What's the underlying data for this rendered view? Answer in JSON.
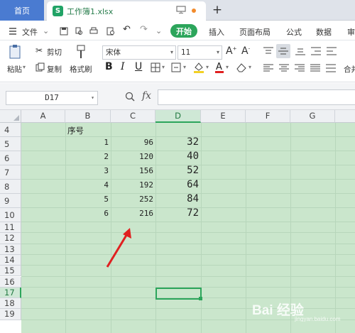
{
  "titlebar": {
    "home_tab": "首页",
    "doc_logo": "S",
    "doc_tab": "工作簿1.xlsx",
    "new_tab": "+"
  },
  "menubar": {
    "file": "文件",
    "start": "开始",
    "items": [
      "插入",
      "页面布局",
      "公式",
      "数据",
      "审"
    ]
  },
  "ribbon": {
    "paste": "粘贴",
    "cut": "剪切",
    "copy": "复制",
    "format_painter": "格式刷",
    "font_name": "宋体",
    "font_size": "11",
    "bold": "B",
    "italic": "I",
    "underline": "U",
    "right_cut": "合并"
  },
  "formula_bar": {
    "name_box": "D17",
    "fx_label": "fx",
    "formula": ""
  },
  "sheet": {
    "columns": [
      "A",
      "B",
      "C",
      "D",
      "E",
      "F",
      "G"
    ],
    "rows": [
      "4",
      "5",
      "6",
      "7",
      "8",
      "9",
      "10",
      "11",
      "12",
      "13",
      "14",
      "15",
      "16",
      "17",
      "18",
      "19"
    ],
    "header_b4": "序号",
    "colB": [
      "1",
      "2",
      "3",
      "4",
      "5",
      "6"
    ],
    "colC": [
      "96",
      "120",
      "156",
      "192",
      "252",
      "216"
    ],
    "colD": [
      "32",
      "40",
      "52",
      "64",
      "84",
      "72"
    ],
    "selected_cell": "D17"
  },
  "watermark": {
    "text": "Bai 经验",
    "url": "jingyan.baidu.com"
  },
  "colors": {
    "accent": "#2ca55b",
    "grid_fill": "#cae6cc",
    "home_tab": "#4a7bd1",
    "arrow": "#e02020"
  }
}
